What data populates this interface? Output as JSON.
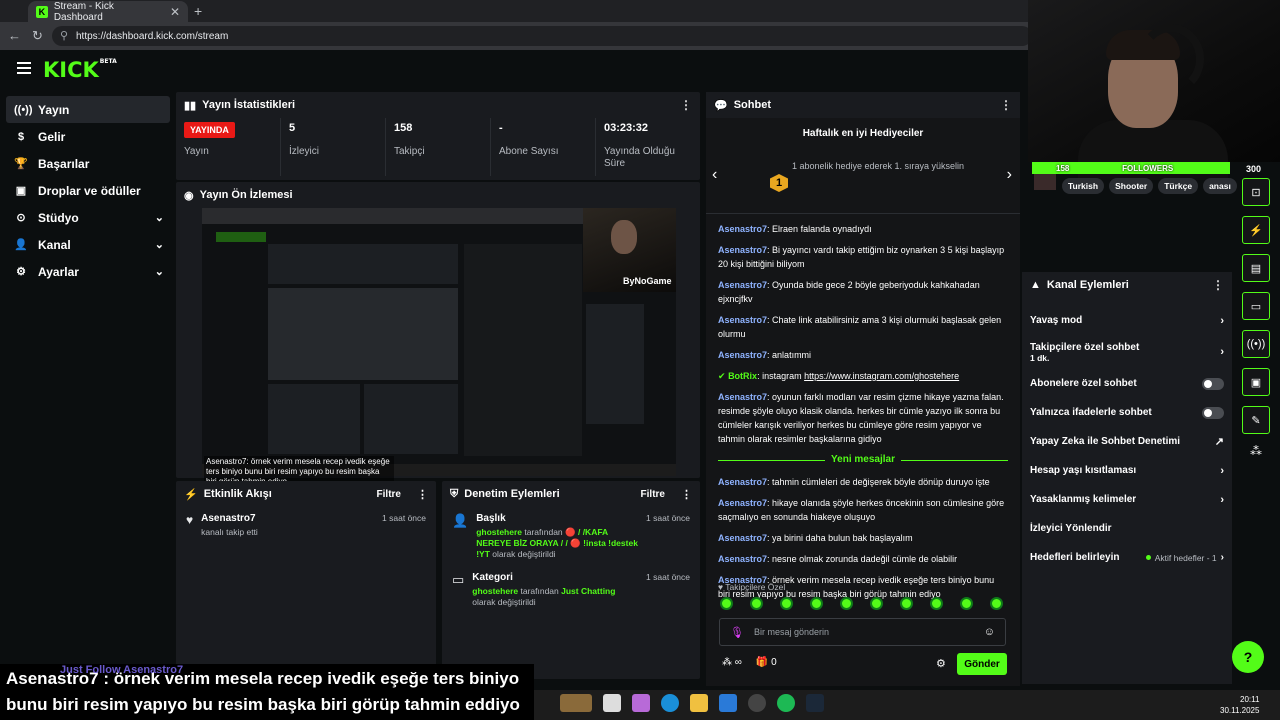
{
  "browser": {
    "tab_title": "Stream - Kick Dashboard",
    "url": "https://dashboard.kick.com/stream",
    "new_tab": "+",
    "close": "✕"
  },
  "app": {
    "logo": "KICK",
    "logo_sup": "BETA"
  },
  "sidebar": {
    "items": [
      {
        "label": "Yayın",
        "icon": "broadcast-icon"
      },
      {
        "label": "Gelir",
        "icon": "dollar-icon"
      },
      {
        "label": "Başarılar",
        "icon": "trophy-icon"
      },
      {
        "label": "Droplar ve ödüller",
        "icon": "gift-icon"
      },
      {
        "label": "Stüdyo",
        "icon": "studio-icon"
      },
      {
        "label": "Kanal",
        "icon": "user-icon"
      },
      {
        "label": "Ayarlar",
        "icon": "gear-icon"
      }
    ]
  },
  "stats": {
    "title": "Yayın İstatistikleri",
    "live": "YAYINDA",
    "live_label": "Yayın",
    "viewers": "5",
    "viewers_label": "İzleyici",
    "followers": "158",
    "followers_label": "Takipçi",
    "subs": "-",
    "subs_label": "Abone Sayısı",
    "duration": "03:23:32",
    "duration_label": "Yayında Olduğu Süre"
  },
  "preview": {
    "title": "Yayın Ön İzlemesi",
    "cam_tag": "ByNoGame",
    "caption": "Asenastro7: örnek verim mesela recep ivedik eşeğe ters biniyo bunu biri resim yapıyo bu resim başka biri görüp tahmin ediyo"
  },
  "activity": {
    "title": "Etkinlik Akışı",
    "filter": "Filtre",
    "events": [
      {
        "name": "Asenastro7",
        "sub": "kanalı takip etti",
        "time": "1 saat önce"
      }
    ]
  },
  "moderation": {
    "title": "Denetim Eylemleri",
    "filter": "Filtre",
    "events": [
      {
        "name": "Başlık",
        "actor": "ghostehere",
        "mid": " tarafından ",
        "value": "🔴 / /KAFA NEREYE BİZ ORAYA / / 🔴 !insta !destek !YT",
        "end": " olarak değiştirildi",
        "time": "1 saat önce"
      },
      {
        "name": "Kategori",
        "actor": "ghostehere",
        "mid": " tarafından ",
        "value": "Just Chatting",
        "end": " olarak değiştirildi",
        "time": "1 saat önce"
      }
    ]
  },
  "chat": {
    "title": "Sohbet",
    "gifters_title": "Haftalık en iyi Hediyeciler",
    "gifters_rank": "1",
    "gifters_sub": "1 abonelik hediye ederek 1. sıraya yükselin",
    "messages": [
      {
        "user": "Asenastro7",
        "text": "Elraen falanda oynadıydı"
      },
      {
        "user": "Asenastro7",
        "text": "Bi yayıncı vardı takip ettiğim biz oynarken 3 5 kişi başlayıp 20 kişi bittiğini biliyom"
      },
      {
        "user": "Asenastro7",
        "text": "Oyunda bide gece 2 böyle geberiyoduk kahkahadan ejxncjfkv"
      },
      {
        "user": "Asenastro7",
        "text": "Chate link atabilirsiniz ama 3 kişi olurmuki başlasak gelen olurmu"
      },
      {
        "user": "Asenastro7",
        "text": "anlatımmi"
      }
    ],
    "bot": {
      "user": "BotRix",
      "text": "instagram ",
      "link": "https://www.instagram.com/ghostehere"
    },
    "messages2": [
      {
        "user": "Asenastro7",
        "text": "oyunun farklı modları var resim çizme hikaye yazma falan. resimde şöyle oluyo klasik olanda. herkes bir cümle yazıyo ilk sonra bu cümleler karışık veriliyor herkes bu cümleye göre resim yapıyor ve tahmin olarak resimler başkalarına gidiyo"
      }
    ],
    "new_messages": "Yeni mesajlar",
    "messages3": [
      {
        "user": "Asenastro7",
        "text": "tahmin cümleleri de değişerek böyle dönüp duruyo işte"
      },
      {
        "user": "Asenastro7",
        "text": "hikaye olanıda şöyle herkes öncekinin son cümlesine göre saçmalıyo en sonunda hiakeye oluşuyo"
      },
      {
        "user": "Asenastro7",
        "text": "ya birini daha bulun bak başlayalım"
      },
      {
        "user": "Asenastro7",
        "text": "nesne olmak zorunda dadeğil cümle de olabilir"
      },
      {
        "user": "Asenastro7",
        "text": "örnek verim mesela recep ivedik eşeğe ters biniyo bunu biri resim yapıyo bu resim başka biri görüp tahmin ediyo"
      }
    ],
    "followers_only": "♥ Takipçilere Özel",
    "input_placeholder": "Bir mesaj gönderin",
    "points": "∞",
    "gifts": "0",
    "send": "Gönder"
  },
  "overlay": {
    "followers_count": "158",
    "followers_label": "FOLLOWERS",
    "followers_goal": "300",
    "tags": [
      "Turkish",
      "Shooter",
      "Türkçe",
      "anası"
    ]
  },
  "channel_actions": {
    "title": "Kanal Eylemleri",
    "items": [
      {
        "label": "Yavaş mod",
        "kind": "chevron"
      },
      {
        "label": "Takipçilere özel sohbet",
        "sub": "1 dk.",
        "kind": "chevron"
      },
      {
        "label": "Abonelere özel sohbet",
        "kind": "toggle"
      },
      {
        "label": "Yalnızca ifadelerle sohbet",
        "kind": "toggle"
      },
      {
        "label": "Yapay Zeka ile Sohbet Denetimi",
        "kind": "external"
      },
      {
        "label": "Hesap yaşı kısıtlaması",
        "kind": "chevron"
      },
      {
        "label": "Yasaklanmış kelimeler",
        "kind": "chevron"
      },
      {
        "label": "İzleyici Yönlendir",
        "kind": "none"
      },
      {
        "label": "Hedefleri belirleyin",
        "aktif": "Aktif hedefler - 1",
        "kind": "chevron"
      }
    ]
  },
  "subtitle": {
    "ghost": "Just Follow Asenastro7",
    "line1": "Asenastro7 : örnek verim mesela recep ivedik eşeğe ters biniyo",
    "line2": "bunu biri resim yapıyo bu resim başka biri görüp tahmin eddiyo"
  },
  "taskbar": {
    "time": "20:11",
    "date": "30.11.2025"
  },
  "colors": {
    "accent": "#53fc18",
    "live": "#e91916",
    "panel": "#191b1f"
  }
}
